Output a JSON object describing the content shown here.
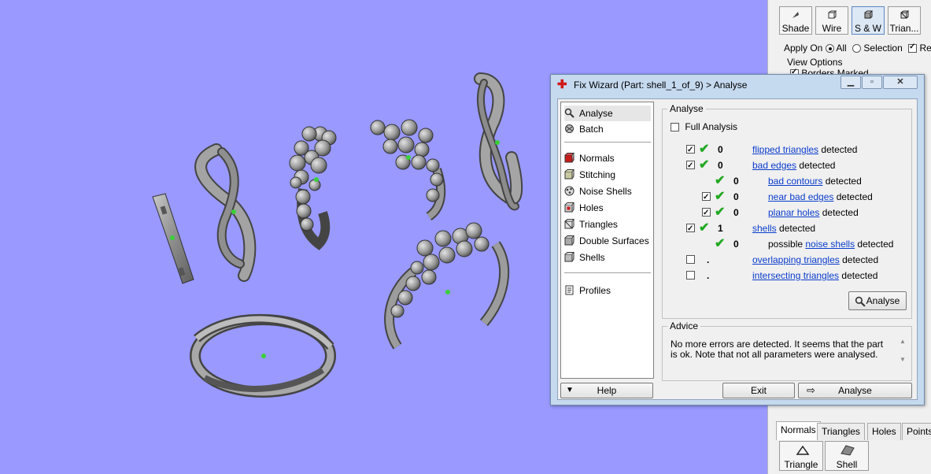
{
  "right_panel": {
    "view_buttons": [
      {
        "label": "Shade",
        "icon": "shade-icon"
      },
      {
        "label": "Wire",
        "icon": "wire-icon"
      },
      {
        "label": "S & W",
        "icon": "shade-wire-icon"
      },
      {
        "label": "Trian...",
        "icon": "triangles-icon"
      }
    ],
    "apply_on_label": "Apply On",
    "apply_all": "All",
    "apply_selection": "Selection",
    "apply_rea": "Rea",
    "view_options_label": "View Options",
    "borders_marked": "Borders Marked",
    "bottom_tabs": [
      "Normals",
      "Triangles",
      "Holes",
      "Points"
    ],
    "bottom_buttons": [
      "Triangle",
      "Shell"
    ]
  },
  "dialog": {
    "title": "Fix Wizard (Part: shell_1_of_9) > Analyse",
    "sidebar": {
      "items_top": [
        {
          "label": "Analyse",
          "icon": "magnifier-icon"
        },
        {
          "label": "Batch",
          "icon": "batch-icon"
        }
      ],
      "items_mid": [
        {
          "label": "Normals",
          "icon": "normals-icon"
        },
        {
          "label": "Stitching",
          "icon": "stitching-icon"
        },
        {
          "label": "Noise Shells",
          "icon": "noise-shells-icon"
        },
        {
          "label": "Holes",
          "icon": "holes-icon"
        },
        {
          "label": "Triangles",
          "icon": "triangles-icon"
        },
        {
          "label": "Double Surfaces",
          "icon": "double-surfaces-icon"
        },
        {
          "label": "Shells",
          "icon": "shells-icon"
        }
      ],
      "items_bottom": [
        {
          "label": "Profiles",
          "icon": "profiles-icon"
        }
      ]
    },
    "analyse": {
      "group_title": "Analyse",
      "full_analysis": "Full Analysis",
      "detected_word": "detected",
      "rows": [
        {
          "count": "0",
          "link": "flipped triangles"
        },
        {
          "count": "0",
          "link": "bad edges"
        },
        {
          "count": "0",
          "link": "bad contours"
        },
        {
          "count": "0",
          "link": "near bad edges"
        },
        {
          "count": "0",
          "link": "planar holes"
        },
        {
          "count": "1",
          "link": "shells"
        },
        {
          "count": "0",
          "prefix": "possible",
          "link": "noise shells"
        },
        {
          "count": ".",
          "link": "overlapping triangles"
        },
        {
          "count": ".",
          "link": "intersecting triangles"
        }
      ],
      "analyse_button": "Analyse"
    },
    "advice": {
      "group_title": "Advice",
      "text": "No more errors are detected. It seems that the part is ok. Note that not all parameters were analysed."
    },
    "bottom": {
      "help": "Help",
      "exit": "Exit",
      "analyse": "Analyse"
    }
  }
}
